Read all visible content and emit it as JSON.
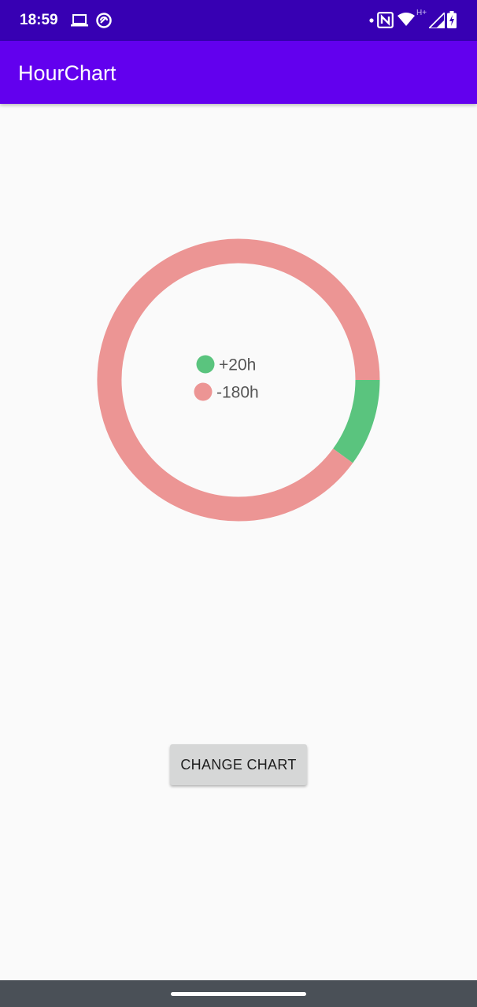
{
  "status_bar": {
    "time": "18:59",
    "network_label": "H+",
    "icons": [
      "laptop-icon",
      "sync-icon",
      "notification-dot-icon",
      "nfc-icon",
      "wifi-icon",
      "signal-icon",
      "battery-charging-icon"
    ],
    "background": "#3700b3"
  },
  "app_bar": {
    "title": "HourChart",
    "background": "#6200ee"
  },
  "chart_data": {
    "type": "pie",
    "style": "donut",
    "slices": [
      {
        "label": "+20h",
        "value": 20,
        "color": "#5ac47e"
      },
      {
        "label": "-180h",
        "value": 180,
        "color": "#ec9594"
      }
    ],
    "legend_placement": "center"
  },
  "controls": {
    "change_chart_label": "CHANGE CHART"
  },
  "colors": {
    "background": "#fafafa",
    "positive": "#5ac47e",
    "negative": "#ec9594",
    "nav_bar": "#4a5057"
  }
}
